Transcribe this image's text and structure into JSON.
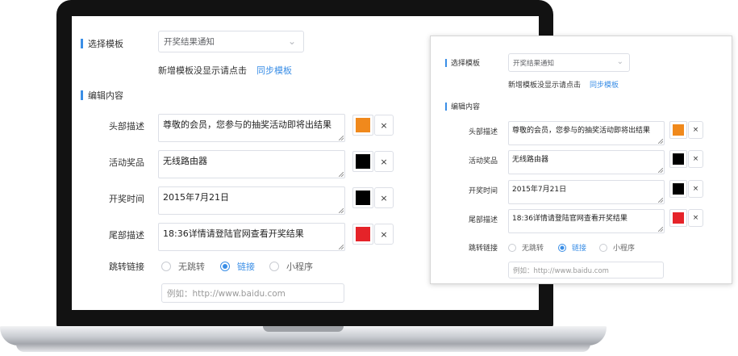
{
  "section_template": "选择模板",
  "template_select": {
    "value": "开奖结果通知"
  },
  "template_hint": "新增模板没显示请点击",
  "sync_template_link": "同步模板",
  "section_content": "编辑内容",
  "fields": [
    {
      "label": "头部描述",
      "value": "尊敬的会员，您参与的抽奖活动即将出结果",
      "color": "#f0891c"
    },
    {
      "label": "活动奖品",
      "value": "无线路由器",
      "color": "#000000"
    },
    {
      "label": "开奖时间",
      "value": "2015年7月21日",
      "color": "#000000"
    },
    {
      "label": "尾部描述",
      "value": "18:36详情请登陆官网查看开奖结果",
      "color": "#e52329"
    }
  ],
  "close_symbol": "×",
  "jump_link": {
    "label": "跳转链接",
    "options": [
      "无跳转",
      "链接",
      "小程序"
    ],
    "selected": "链接"
  },
  "url_input": {
    "placeholder": "例如：http://www.baidu.com"
  },
  "colors": {
    "accent": "#3a8ee6",
    "laptop_bezel": "#121212"
  }
}
